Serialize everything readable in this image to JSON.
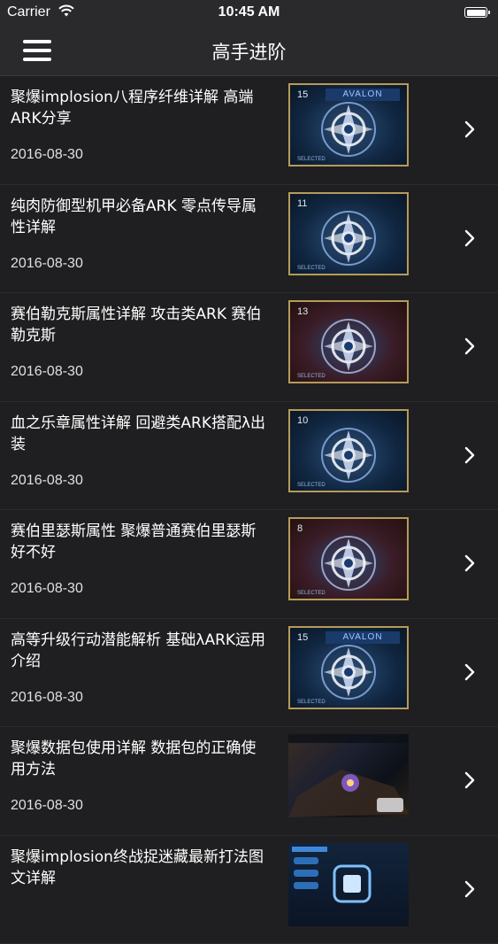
{
  "status_bar": {
    "carrier": "Carrier",
    "time": "10:45 AM"
  },
  "nav": {
    "title": "高手进阶",
    "menu_icon": "hamburger-menu-icon"
  },
  "articles": [
    {
      "title": "聚爆implosion八程序纤维详解 高端ARK分享",
      "date": "2016-08-30",
      "thumb": {
        "style": "blue",
        "level": "15",
        "brand": "AVALON",
        "caption": "SELECTED"
      }
    },
    {
      "title": "纯肉防御型机甲必备ARK 零点传导属性详解",
      "date": "2016-08-30",
      "thumb": {
        "style": "blue",
        "level": "11",
        "brand": "",
        "caption": "SELECTED"
      }
    },
    {
      "title": "赛伯勒克斯属性详解 攻击类ARK 赛伯勒克斯",
      "date": "2016-08-30",
      "thumb": {
        "style": "red",
        "level": "13",
        "brand": "",
        "caption": "SELECTED"
      }
    },
    {
      "title": "血之乐章属性详解 回避类ARK搭配λ出装",
      "date": "2016-08-30",
      "thumb": {
        "style": "blue",
        "level": "10",
        "brand": "",
        "caption": "SELECTED"
      }
    },
    {
      "title": "赛伯里瑟斯属性 聚爆普通赛伯里瑟斯好不好",
      "date": "2016-08-30",
      "thumb": {
        "style": "red",
        "level": "8",
        "brand": "",
        "caption": "SELECTED"
      }
    },
    {
      "title": "高等升级行动潜能解析 基础λARK运用介绍",
      "date": "2016-08-30",
      "thumb": {
        "style": "blue",
        "level": "15",
        "brand": "AVALON",
        "caption": "SELECTED"
      }
    },
    {
      "title": "聚爆数据包使用详解 数据包的正确使用方法",
      "date": "2016-08-30",
      "thumb": {
        "style": "game",
        "level": "",
        "brand": "",
        "caption": ""
      }
    },
    {
      "title": "聚爆implosion终战捉迷藏最新打法图文详解",
      "date": "",
      "thumb": {
        "style": "ui",
        "level": "",
        "brand": "",
        "caption": ""
      }
    }
  ]
}
